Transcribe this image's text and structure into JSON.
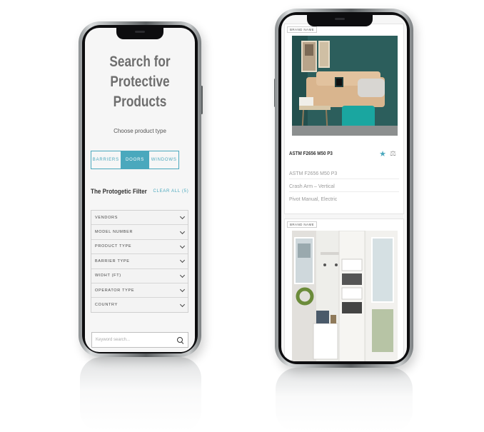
{
  "left_phone": {
    "heading": "Search for Protective Products",
    "subtitle": "Choose product type",
    "tabs": [
      {
        "label": "BARRIERS",
        "active": false
      },
      {
        "label": "DOORS",
        "active": true
      },
      {
        "label": "WINDOWS",
        "active": false
      }
    ],
    "filter_title": "The Protogetic Filter",
    "clear_all": "CLEAR ALL (5)",
    "filters": [
      "VENDORS",
      "MODEL NUMBER",
      "PRODUCT TYPE",
      "BARRIER TYPE",
      "WIDHT (FT)",
      "OPERATOR TYPE",
      "COUNTRY"
    ],
    "search_placeholder": "Keyword search..."
  },
  "right_phone": {
    "cards": [
      {
        "badge": "BRAND NAME",
        "name": "ASTM F2656 M50 P3",
        "specs": [
          "ASTM F2656 M50 P3",
          "Crash Arm – Vertical",
          "Pivot Manual, Electric"
        ],
        "favorited": true
      },
      {
        "badge": "BRAND NAME"
      }
    ]
  },
  "colors": {
    "accent": "#4aa8bd",
    "screen_bg": "#f6f6f6"
  },
  "icons": [
    "chevron-down-icon",
    "search-icon",
    "star-icon",
    "scale-icon"
  ]
}
